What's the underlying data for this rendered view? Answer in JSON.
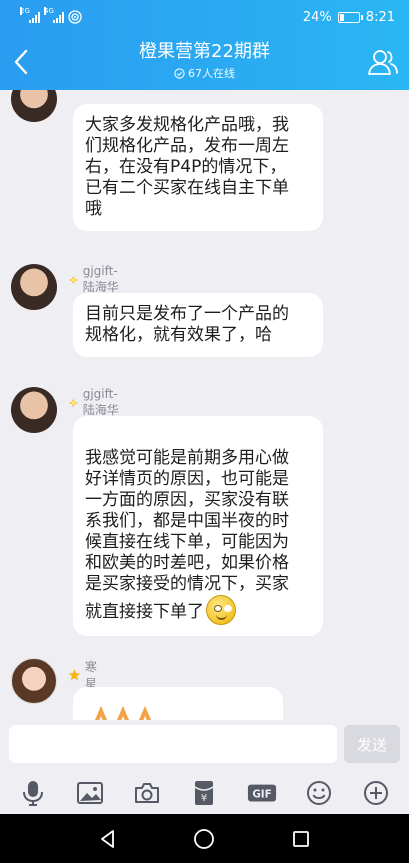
{
  "status_bar": {
    "net1": "2G",
    "net2": "4G",
    "battery_text": "24%",
    "time": "8:21",
    "battery_level": 0.24
  },
  "header": {
    "title": "橙果营第22期群",
    "online_text": "67人在线"
  },
  "messages": [
    {
      "sender": "",
      "avatar": "avatar-hai",
      "text": "大家多发规格化产品哦，我\n们规格化产品，发布一周左\n右，在没有P4P的情况下，\n已有二个买家在线自主下单\n哦"
    },
    {
      "sender": "gjgift-陆海华",
      "badge": "diamond-badge",
      "avatar": "avatar-hai",
      "text": "目前只是发布了一个产品的\n规格化，就有效果了，哈"
    },
    {
      "sender": "gjgift-陆海华",
      "badge": "diamond-badge",
      "avatar": "avatar-hai",
      "text": "我感觉可能是前期多用心做\n好详情页的原因，也可能是\n一方面的原因，买家没有联\n系我们，都是中国半夜的时\n候直接在线下单，可能因为\n和欧美的时差吧，如果价格\n是买家接受的情况下，买家\n就直接接下单了"
    },
    {
      "sender": "寒星",
      "badge": "star-badge",
      "avatar": "avatar-hanxing",
      "text": ""
    }
  ],
  "input": {
    "value": "",
    "send_label": "发送"
  },
  "toolbar": {
    "gif_label": "GIF",
    "yen_label": "¥",
    "icons": [
      "microphone-icon",
      "image-icon",
      "camera-icon",
      "red-packet-icon",
      "gif-icon",
      "emoji-icon",
      "plus-icon"
    ]
  },
  "colors": {
    "header_start": "#2a9cf0",
    "header_end": "#2ab6f4",
    "chat_bg": "#eeeef3",
    "bubble_bg": "#ffffff",
    "send_disabled": "#d9dadf"
  }
}
